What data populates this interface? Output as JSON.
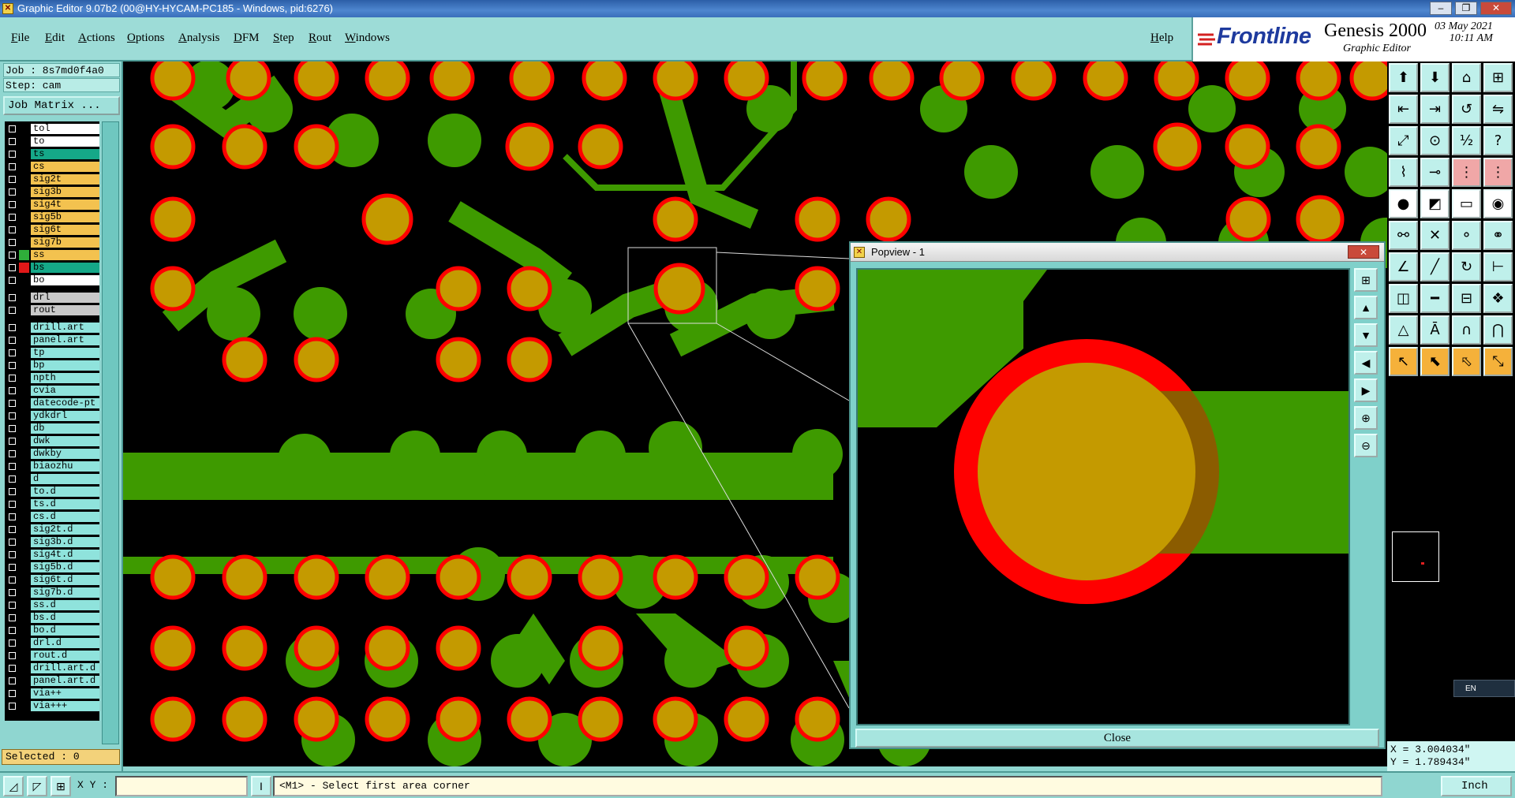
{
  "window": {
    "title": "Graphic Editor 9.07b2 (00@HY-HYCAM-PC185 - Windows, pid:6276)",
    "controls": [
      "–",
      "❐",
      "✕"
    ]
  },
  "menu": {
    "items": [
      "File",
      "Edit",
      "Actions",
      "Options",
      "Analysis",
      "DFM",
      "Step",
      "Rout",
      "Windows"
    ],
    "help": "Help"
  },
  "brand": {
    "logo": "Frontline",
    "product": "Genesis 2000",
    "subtitle": "Graphic Editor",
    "date": "03 May 2021",
    "time": "10:11 AM"
  },
  "job": {
    "job_label": "Job : 8s7md0f4a0",
    "step_label": "Step: cam",
    "matrix_button": "Job Matrix ..."
  },
  "layers": [
    {
      "name": "tol",
      "bg": "#ffffff",
      "swatch": "#000000"
    },
    {
      "name": "to",
      "bg": "#ffffff",
      "swatch": "#000000"
    },
    {
      "name": "ts",
      "bg": "#15a888",
      "swatch": "#000000"
    },
    {
      "name": "cs",
      "bg": "#f3c24f",
      "swatch": "#000000"
    },
    {
      "name": "sig2t",
      "bg": "#f3c24f",
      "swatch": "#000000"
    },
    {
      "name": "sig3b",
      "bg": "#f3c24f",
      "swatch": "#000000"
    },
    {
      "name": "sig4t",
      "bg": "#f3c24f",
      "swatch": "#000000"
    },
    {
      "name": "sig5b",
      "bg": "#f3c24f",
      "swatch": "#000000"
    },
    {
      "name": "sig6t",
      "bg": "#f3c24f",
      "swatch": "#000000"
    },
    {
      "name": "sig7b",
      "bg": "#f3c24f",
      "swatch": "#000000"
    },
    {
      "name": "ss",
      "bg": "#f3c24f",
      "swatch": "#2fae3a"
    },
    {
      "name": "bs",
      "bg": "#15a888",
      "swatch": "#e01818"
    },
    {
      "name": "bo",
      "bg": "#ffffff",
      "swatch": "#000000"
    },
    {
      "name": "drl",
      "bg": "#c9c9c9",
      "swatch": "#000000"
    },
    {
      "name": "rout",
      "bg": "#c9c9c9",
      "swatch": "#000000"
    },
    {
      "name": "drill.art",
      "bg": "#8fe3dc",
      "swatch": "#000000"
    },
    {
      "name": "panel.art",
      "bg": "#8fe3dc",
      "swatch": "#000000"
    },
    {
      "name": "tp",
      "bg": "#8fe3dc",
      "swatch": "#000000"
    },
    {
      "name": "bp",
      "bg": "#8fe3dc",
      "swatch": "#000000"
    },
    {
      "name": "npth",
      "bg": "#8fe3dc",
      "swatch": "#000000"
    },
    {
      "name": "cvia",
      "bg": "#8fe3dc",
      "swatch": "#000000"
    },
    {
      "name": "datecode-pt",
      "bg": "#8fe3dc",
      "swatch": "#000000"
    },
    {
      "name": "ydkdrl",
      "bg": "#8fe3dc",
      "swatch": "#000000"
    },
    {
      "name": "db",
      "bg": "#8fe3dc",
      "swatch": "#000000"
    },
    {
      "name": "dwk",
      "bg": "#8fe3dc",
      "swatch": "#000000"
    },
    {
      "name": "dwkby",
      "bg": "#8fe3dc",
      "swatch": "#000000"
    },
    {
      "name": "biaozhu",
      "bg": "#8fe3dc",
      "swatch": "#000000"
    },
    {
      "name": "d",
      "bg": "#8fe3dc",
      "swatch": "#000000"
    },
    {
      "name": "to.d",
      "bg": "#8fe3dc",
      "swatch": "#000000"
    },
    {
      "name": "ts.d",
      "bg": "#8fe3dc",
      "swatch": "#000000"
    },
    {
      "name": "cs.d",
      "bg": "#8fe3dc",
      "swatch": "#000000"
    },
    {
      "name": "sig2t.d",
      "bg": "#8fe3dc",
      "swatch": "#000000"
    },
    {
      "name": "sig3b.d",
      "bg": "#8fe3dc",
      "swatch": "#000000"
    },
    {
      "name": "sig4t.d",
      "bg": "#8fe3dc",
      "swatch": "#000000"
    },
    {
      "name": "sig5b.d",
      "bg": "#8fe3dc",
      "swatch": "#000000"
    },
    {
      "name": "sig6t.d",
      "bg": "#8fe3dc",
      "swatch": "#000000"
    },
    {
      "name": "sig7b.d",
      "bg": "#8fe3dc",
      "swatch": "#000000"
    },
    {
      "name": "ss.d",
      "bg": "#8fe3dc",
      "swatch": "#000000"
    },
    {
      "name": "bs.d",
      "bg": "#8fe3dc",
      "swatch": "#000000"
    },
    {
      "name": "bo.d",
      "bg": "#8fe3dc",
      "swatch": "#000000"
    },
    {
      "name": "drl.d",
      "bg": "#8fe3dc",
      "swatch": "#000000"
    },
    {
      "name": "rout.d",
      "bg": "#8fe3dc",
      "swatch": "#000000"
    },
    {
      "name": "drill.art.d",
      "bg": "#8fe3dc",
      "swatch": "#000000"
    },
    {
      "name": "panel.art.d",
      "bg": "#8fe3dc",
      "swatch": "#000000"
    },
    {
      "name": "via++",
      "bg": "#8fe3dc",
      "swatch": "#000000"
    },
    {
      "name": "via+++",
      "bg": "#8fe3dc",
      "swatch": "#000000"
    }
  ],
  "selected": "Selected : 0",
  "popview": {
    "title": "Popview - 1",
    "close_label": "Close"
  },
  "coords": {
    "x": "X = 3.004034\"",
    "y": "Y = 1.789434\""
  },
  "language_indicator": "EN",
  "status": {
    "xy_label": "X Y :",
    "xy_value": "",
    "message": "<M1> - Select first area corner",
    "unit": "Inch"
  },
  "colors": {
    "copper_green": "#3e9a00",
    "pad_gold": "#c49a00",
    "mask_red": "#ff0000",
    "panel_teal": "#8fd6d0"
  }
}
